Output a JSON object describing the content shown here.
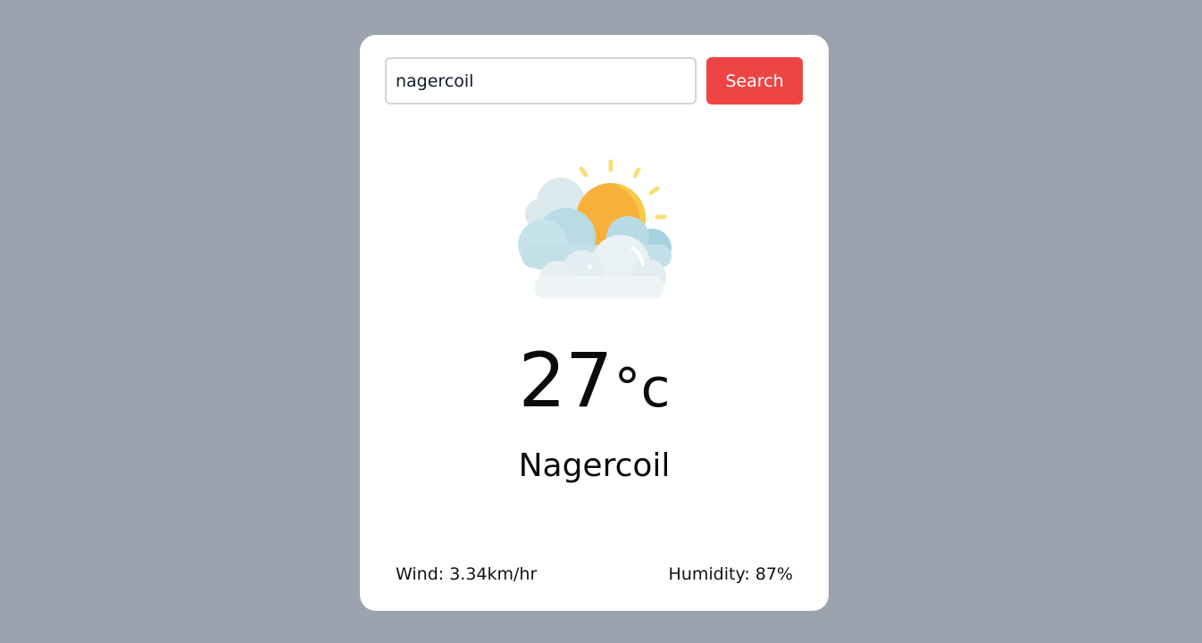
{
  "search": {
    "value": "nagercoil",
    "button_label": "Search"
  },
  "weather": {
    "icon": "partly-cloudy-sun-icon",
    "temperature": "27",
    "unit": "°c",
    "city": "Nagercoil",
    "wind_text": "Wind: 3.34km/hr",
    "humidity_text": "Humidity: 87%"
  },
  "colors": {
    "background": "#9ca3af",
    "card": "#ffffff",
    "accent": "#ef4444",
    "sun": "#f6b93b",
    "cloud": "#b7dbe3"
  }
}
